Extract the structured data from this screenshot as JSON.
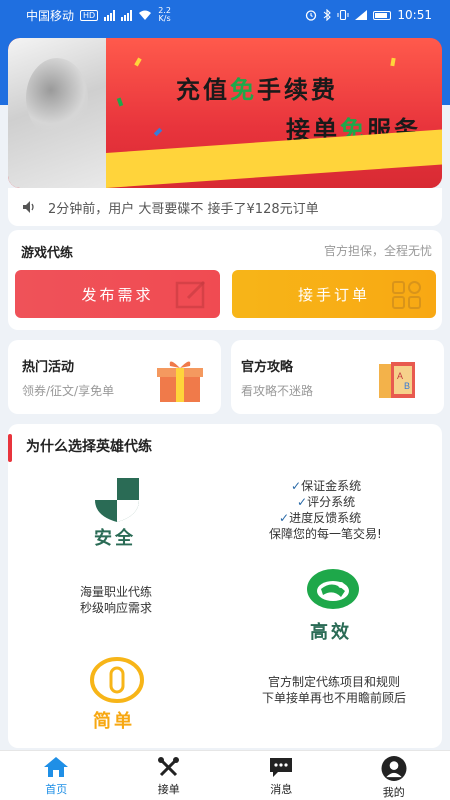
{
  "status_bar": {
    "carrier": "中国移动",
    "hd": "HD",
    "net_speed": "2.2\nK/s",
    "time": "10:51"
  },
  "banner": {
    "line1_a": "充值",
    "line1_hl": "免",
    "line1_b": "手续费",
    "line2_a": "接单",
    "line2_hl": "免",
    "line2_b": "服务"
  },
  "ticker": {
    "text": "2分钟前，用户 大哥要碟不 接手了¥128元订单"
  },
  "game_section": {
    "title": "游戏代练",
    "subtitle": "官方担保，全程无忧",
    "post_button": "发布需求",
    "take_button": "接手订单"
  },
  "hot_activity": {
    "title": "热门活动",
    "subtitle": "领券/征文/享免单"
  },
  "official_guide": {
    "title": "官方攻略",
    "subtitle": "看攻略不迷路"
  },
  "why": {
    "title": "为什么选择英雄代练",
    "safe_label": "安全",
    "safe_points": [
      "保证金系统",
      "评分系统",
      "进度反馈系统"
    ],
    "safe_tagline": "保障您的每一笔交易!",
    "efficient_text_1": "海量职业代练",
    "efficient_text_2": "秒级响应需求",
    "efficient_label": "高效",
    "simple_label": "简单",
    "simple_text_1": "官方制定代练项目和规则",
    "simple_text_2": "下单接单再也不用瞻前顾后"
  },
  "tabbar": {
    "tabs": [
      {
        "label": "首页",
        "icon": "home-icon"
      },
      {
        "label": "接单",
        "icon": "take-order-icon"
      },
      {
        "label": "消息",
        "icon": "message-icon"
      },
      {
        "label": "我的",
        "icon": "profile-icon"
      }
    ],
    "active_index": 0
  },
  "colors": {
    "primary_blue": "#1f6fe0",
    "red": "#ef5259",
    "orange": "#f7b518",
    "green": "#2a6b55",
    "tab_active": "#1f8fe6"
  }
}
